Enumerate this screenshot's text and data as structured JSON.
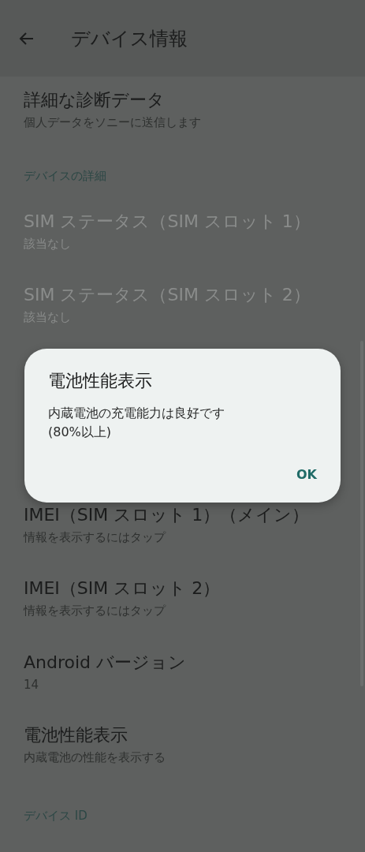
{
  "app_bar": {
    "title": "デバイス情報"
  },
  "items": [
    {
      "kind": "item",
      "title": "詳細な診断データ",
      "summary": "個人データをソニーに送信します",
      "disabled": false
    },
    {
      "kind": "header",
      "title": "デバイスの詳細"
    },
    {
      "kind": "item",
      "title": "SIM ステータス（SIM スロット 1）",
      "summary": "該当なし",
      "disabled": true
    },
    {
      "kind": "item",
      "title": "SIM ステータス（SIM スロット 2）",
      "summary": "該当なし",
      "disabled": true
    }
  ],
  "items_below_dialog": [
    {
      "kind": "item",
      "title": "IMEI（SIM スロット 1）（メイン）",
      "summary": "情報を表示するにはタップ",
      "disabled": false
    },
    {
      "kind": "item",
      "title": "IMEI（SIM スロット 2）",
      "summary": "情報を表示するにはタップ",
      "disabled": false
    },
    {
      "kind": "item",
      "title": "Android バージョン",
      "summary": "14",
      "disabled": false
    },
    {
      "kind": "item",
      "title": "電池性能表示",
      "summary": "内蔵電池の性能を表示する",
      "disabled": false
    },
    {
      "kind": "header",
      "title": "デバイス ID"
    }
  ],
  "dialog": {
    "title": "電池性能表示",
    "message": "内蔵電池の充電能力は良好です\n(80%以上)",
    "button": "OK"
  }
}
